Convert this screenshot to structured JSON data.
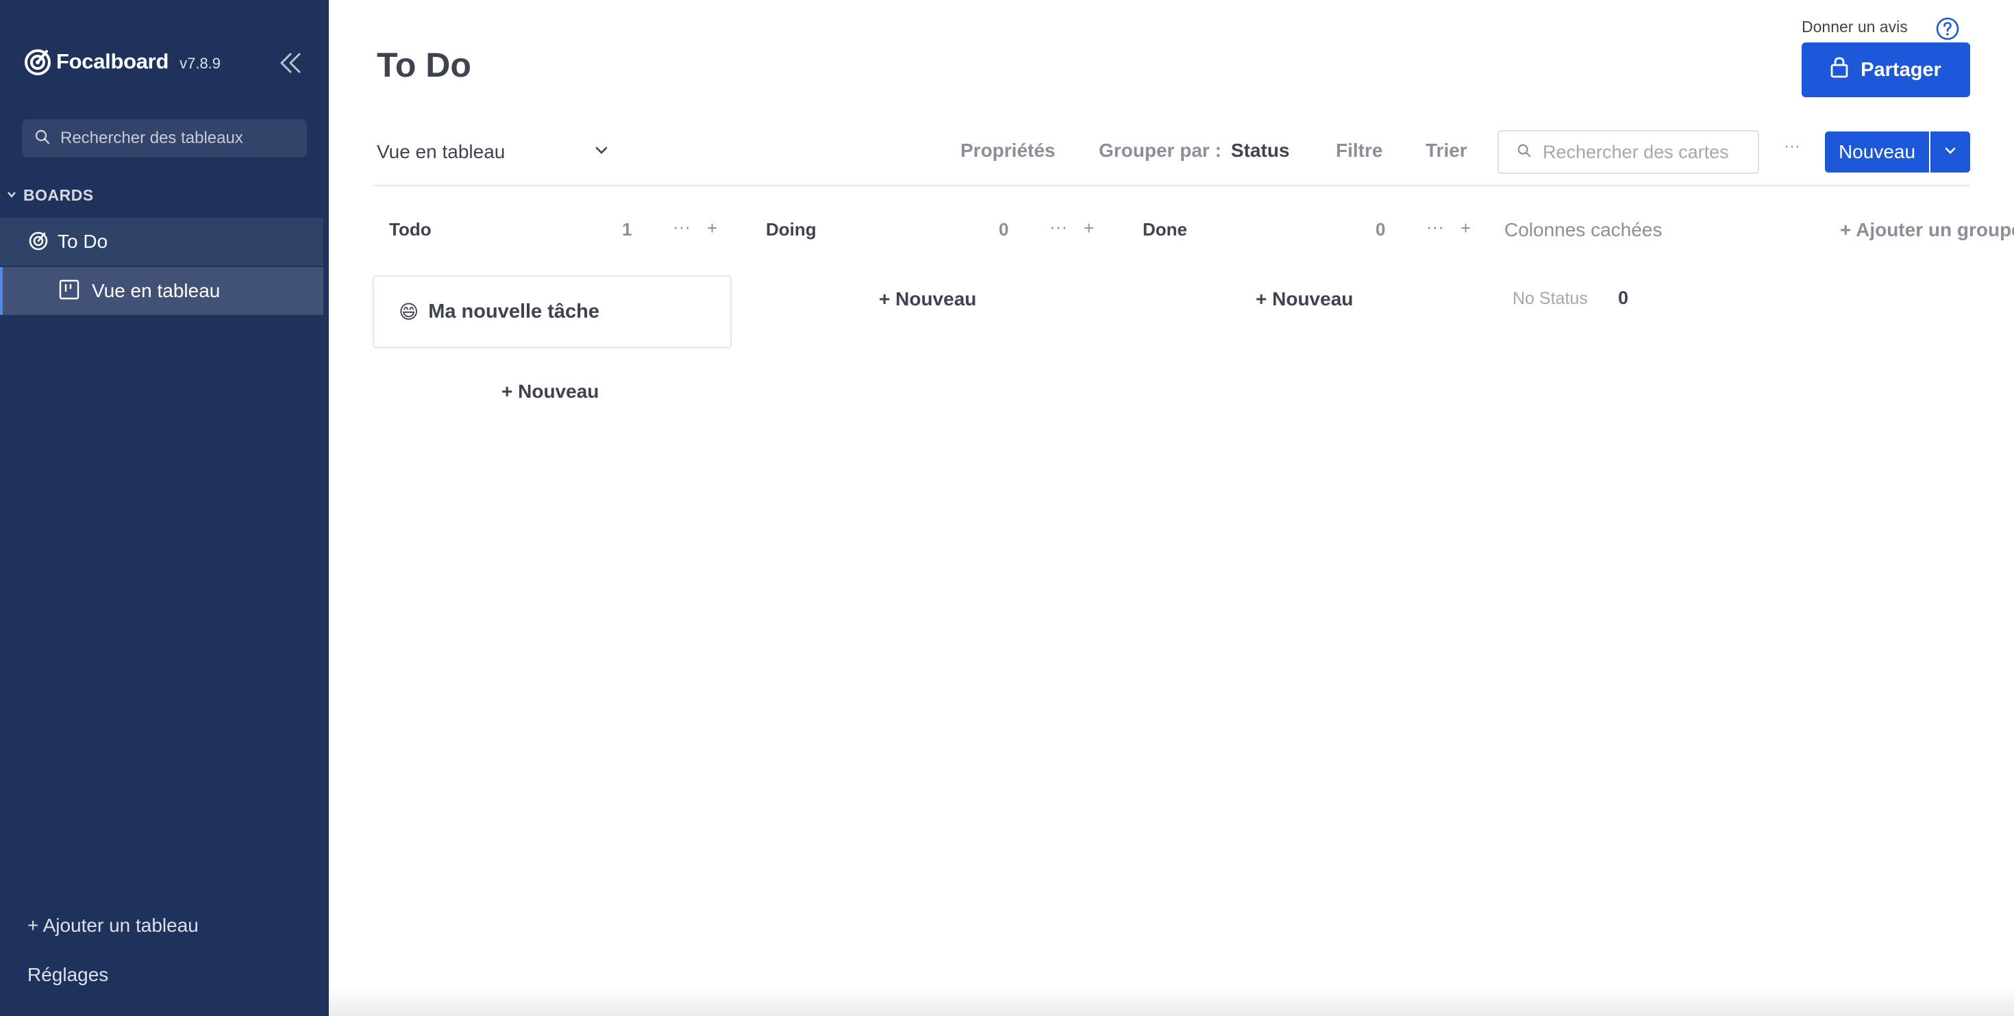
{
  "sidebar": {
    "brand_name": "Focalboard",
    "version": "v7.8.9",
    "search_placeholder": "Rechercher des tableaux",
    "section_label": "BOARDS",
    "board_label": "To Do",
    "view_label": "Vue en tableau",
    "add_board": "+ Ajouter un tableau",
    "settings": "Réglages",
    "icons": [
      "focalboard-logo-icon",
      "double-chevron-left-icon",
      "search-icon",
      "chevron-down-icon",
      "board-target-icon",
      "board-view-icon"
    ]
  },
  "header": {
    "title": "To Do",
    "feedback": "Donner un avis",
    "share_label": "Partager",
    "icons": [
      "help-icon",
      "lock-icon"
    ]
  },
  "toolbar": {
    "view_select": "Vue en tableau",
    "properties": "Propriétés",
    "group_by_label": "Grouper par :",
    "group_by_value": "Status",
    "filter": "Filtre",
    "sort": "Trier",
    "search_placeholder": "Rechercher des cartes",
    "more": "···",
    "new_label": "Nouveau"
  },
  "board": {
    "columns": [
      {
        "title": "Todo",
        "count": "1",
        "more": "···",
        "add": "+"
      },
      {
        "title": "Doing",
        "count": "0",
        "more": "···",
        "add": "+"
      },
      {
        "title": "Done",
        "count": "0",
        "more": "···",
        "add": "+"
      }
    ],
    "hidden_columns_label": "Colonnes cachées",
    "add_group": "+ Ajouter un groupe",
    "add_new": "+ Nouveau",
    "cards": [
      {
        "emoji": "😄",
        "title": "Ma nouvelle tâche"
      }
    ],
    "hidden_groups": [
      {
        "label": "No Status",
        "count": "0"
      }
    ]
  },
  "colors": {
    "sidebar_bg": "#1e325c",
    "accent": "#1c58d9",
    "text": "#3f4350",
    "muted": "#8c8f98"
  }
}
